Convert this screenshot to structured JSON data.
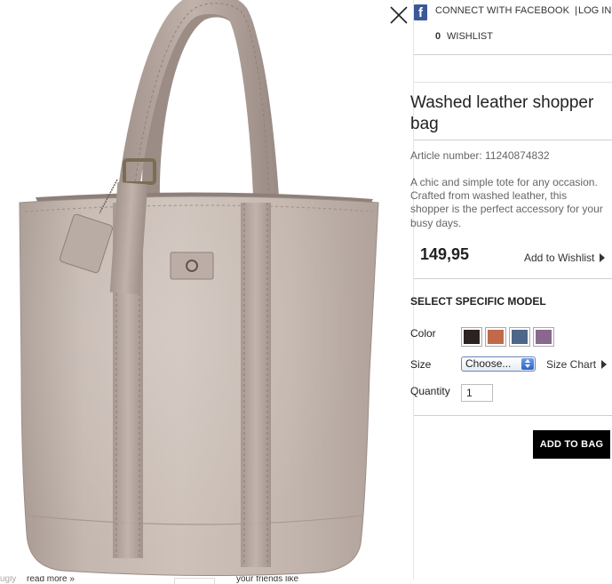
{
  "header": {
    "facebook_icon_letter": "f",
    "connect_facebook": "CONNECT WITH FACEBOOK",
    "separator": "|",
    "login": "LOG IN",
    "wishlist_count": "0",
    "wishlist": "WISHLIST"
  },
  "product": {
    "title": "Washed leather shopper bag",
    "article_number": "Article number: 11240874832",
    "description": "A chic and simple tote for any occasion. Crafted from washed leather, this shopper is the perfect accessory for your busy days.",
    "price": "149,95",
    "add_to_wishlist": "Add to Wishlist",
    "image_icon": "leather-shopper-bag-image"
  },
  "options": {
    "heading": "SELECT SPECIFIC MODEL",
    "color_label": "Color",
    "colors": [
      {
        "name": "dark-brown",
        "hex": "#2b2322"
      },
      {
        "name": "cognac",
        "hex": "#c06a4b"
      },
      {
        "name": "blue",
        "hex": "#4e6688"
      },
      {
        "name": "purple",
        "hex": "#8b668f"
      }
    ],
    "size_label": "Size",
    "size_selected": "Choose...",
    "size_chart": "Size Chart",
    "quantity_label": "Quantity",
    "quantity_value": "1"
  },
  "actions": {
    "add_to_bag": "ADD TO BAG",
    "close_icon": "close-icon"
  },
  "footer": {
    "left_text": "ugly",
    "read_more": "read more »",
    "friends_text": "your friends like"
  },
  "colors": {
    "button_bg": "#000000",
    "button_text": "#ffffff",
    "facebook_blue": "#3b5998",
    "bag_leather": "#c2b5ad"
  }
}
